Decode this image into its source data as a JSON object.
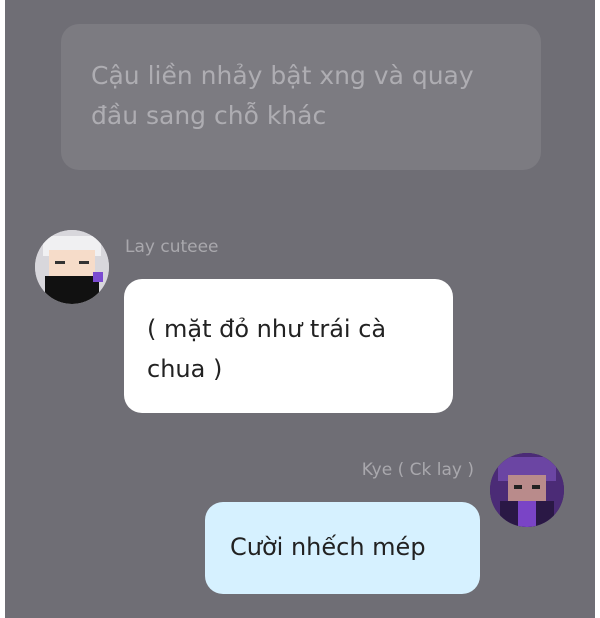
{
  "narration": {
    "text": "Cậu liền nhảy bật xng và quay đầu sang chỗ khác"
  },
  "messages": [
    {
      "speaker": "Lay cuteee",
      "text": "( mặt đỏ như trái cà chua )",
      "avatar_icon": "user-avatar-icon"
    },
    {
      "speaker": "Kye ( Ck lay )",
      "text": "Cười nhếch mép",
      "avatar_icon": "user-avatar-icon"
    }
  ],
  "colors": {
    "background": "#6f6e75",
    "narration_bubble": "#7c7b81",
    "left_bubble": "#ffffff",
    "right_bubble": "#d6f1ff"
  }
}
